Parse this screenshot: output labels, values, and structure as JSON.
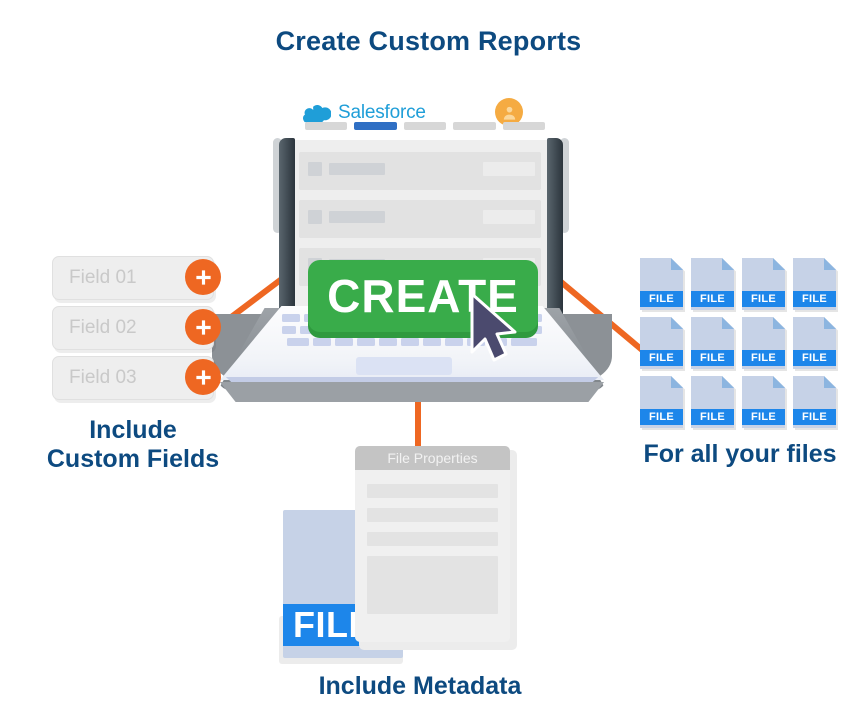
{
  "title": "Create Custom Reports",
  "captions": {
    "left": [
      "Include",
      "Custom Fields"
    ],
    "right": "For all your files",
    "bottom": "Include Metadata"
  },
  "colors": {
    "navy": "#0d4a80",
    "orange": "#ee6722",
    "green": "#39ac4a",
    "salesforce_blue": "#1f9ed8",
    "tab_active_blue": "#2f6fc4",
    "file_blue": "#1d86ea",
    "avatar_amber": "#f5ab42"
  },
  "laptop": {
    "brand": {
      "logo_icon": "salesforce-cloud-icon",
      "name": "Salesforce",
      "avatar_icon": "user-avatar-icon"
    },
    "tabs": [
      {
        "label": "",
        "active": false
      },
      {
        "label": "",
        "active": true
      },
      {
        "label": "",
        "active": false
      },
      {
        "label": "",
        "active": false
      },
      {
        "label": "",
        "active": false
      }
    ],
    "screen_rows": [
      {
        "checkbox": "",
        "label": "",
        "value": ""
      },
      {
        "checkbox": "",
        "label": "",
        "value": ""
      },
      {
        "checkbox": "",
        "label": "",
        "value": ""
      }
    ],
    "create_button": {
      "label": "CREATE",
      "cursor_icon": "mouse-pointer-icon"
    },
    "keyboard_rows": [
      14,
      14,
      13
    ],
    "trackpad": "trackpad"
  },
  "fields": [
    {
      "label": "Field 01",
      "add_icon": "plus-icon"
    },
    {
      "label": "Field 02",
      "add_icon": "plus-icon"
    },
    {
      "label": "Field 03",
      "add_icon": "plus-icon"
    }
  ],
  "file_grid": {
    "columns": 4,
    "rows": 3,
    "file_label": "FILE",
    "items": [
      "FILE",
      "FILE",
      "FILE",
      "FILE",
      "FILE",
      "FILE",
      "FILE",
      "FILE",
      "FILE",
      "FILE",
      "FILE",
      "FILE"
    ]
  },
  "metadata": {
    "file_label": "FILE",
    "panel_title": "File Properties",
    "panel_rows": [
      "",
      "",
      "",
      ""
    ]
  },
  "connectors": [
    {
      "name": "laptop-to-fields",
      "color": "#ee6722"
    },
    {
      "name": "laptop-to-files",
      "color": "#ee6722"
    },
    {
      "name": "laptop-to-metadata",
      "color": "#ee6722"
    }
  ]
}
